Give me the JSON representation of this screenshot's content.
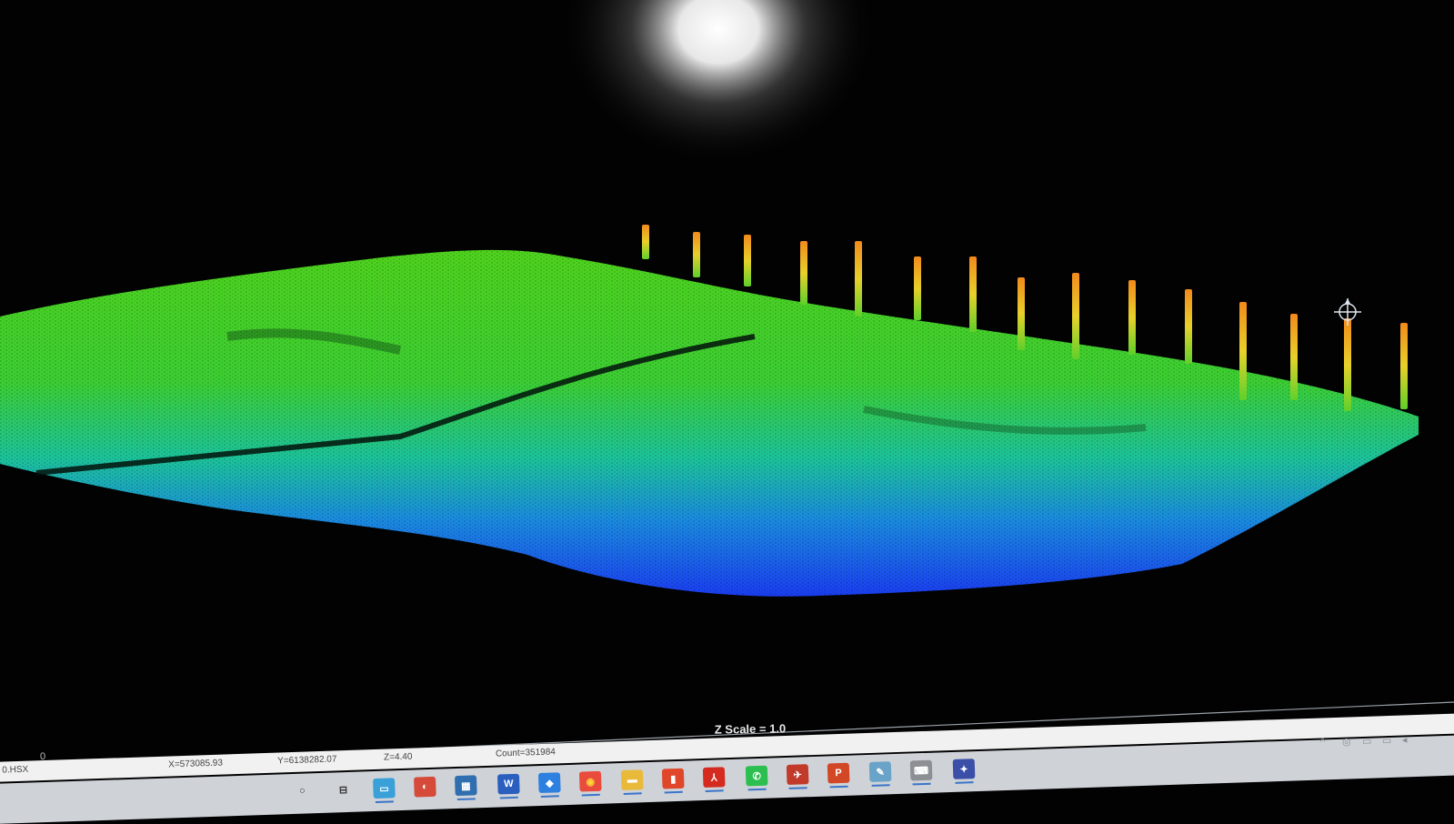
{
  "viewer": {
    "z_scale_label": "Z Scale = 1.0",
    "axis_zero_label": "0"
  },
  "status_bar": {
    "file": "0.HSX",
    "x": "X=573085.93",
    "y": "Y=6138282.07",
    "z": "Z=4.40",
    "count": "Count=351984"
  },
  "colors": {
    "background": "#020203",
    "terrain_high": "#49d21f",
    "terrain_mid": "#1fc79a",
    "terrain_low": "#1a4ff0",
    "piles": "#f0a020"
  },
  "taskbar": {
    "icons": [
      {
        "name": "search-icon",
        "glyph": "○",
        "color": "transparent",
        "fg": "#333"
      },
      {
        "name": "task-view-icon",
        "glyph": "⊟",
        "color": "transparent",
        "fg": "#333"
      },
      {
        "name": "explorer-icon",
        "glyph": "▭",
        "color": "#3aa0d8",
        "fg": "#fff"
      },
      {
        "name": "app-orb-icon",
        "glyph": "◐",
        "color": "#d64a3a",
        "fg": "#fff"
      },
      {
        "name": "calculator-icon",
        "glyph": "▦",
        "color": "#2f6fb0",
        "fg": "#fff"
      },
      {
        "name": "word-icon",
        "glyph": "W",
        "color": "#2b5fbf",
        "fg": "#fff"
      },
      {
        "name": "dropbox-icon",
        "glyph": "◆",
        "color": "#2d7fe0",
        "fg": "#fff"
      },
      {
        "name": "chrome-icon",
        "glyph": "◉",
        "color": "#e94b3c",
        "fg": "#ffd43b"
      },
      {
        "name": "folder-icon",
        "glyph": "▬",
        "color": "#e9b93a",
        "fg": "#fff"
      },
      {
        "name": "office-icon",
        "glyph": "▮",
        "color": "#e0462a",
        "fg": "#fff"
      },
      {
        "name": "acrobat-icon",
        "glyph": "⅄",
        "color": "#d42a1f",
        "fg": "#fff"
      },
      {
        "name": "whatsapp-icon",
        "glyph": "✆",
        "color": "#2cbf4f",
        "fg": "#fff"
      },
      {
        "name": "sonar-app-icon",
        "glyph": "✈",
        "color": "#c23a2a",
        "fg": "#fff"
      },
      {
        "name": "powerpoint-icon",
        "glyph": "P",
        "color": "#d24726",
        "fg": "#fff"
      },
      {
        "name": "notes-icon",
        "glyph": "✎",
        "color": "#6aa3c8",
        "fg": "#fff"
      },
      {
        "name": "keyboard-icon",
        "glyph": "⌨",
        "color": "#8c8f94",
        "fg": "#fff"
      },
      {
        "name": "point-cloud-app-icon",
        "glyph": "✦",
        "color": "#3b4fa8",
        "fg": "#fff"
      }
    ],
    "tray": {
      "chevron": "^",
      "icons": [
        "◎",
        "▭",
        "▭",
        "◂"
      ]
    }
  }
}
